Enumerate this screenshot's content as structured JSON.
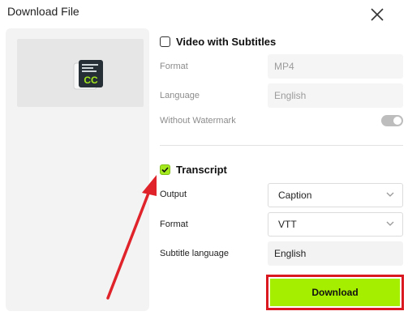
{
  "dialog": {
    "title": "Download File"
  },
  "video_section": {
    "title": "Video with Subtitles",
    "checked": false,
    "format_label": "Format",
    "format_value": "MP4",
    "language_label": "Language",
    "language_value": "English",
    "watermark_label": "Without Watermark",
    "watermark_enabled": true
  },
  "transcript_section": {
    "title": "Transcript",
    "checked": true,
    "output_label": "Output",
    "output_value": "Caption",
    "format_label": "Format",
    "format_value": "VTT",
    "subtitle_language_label": "Subtitle language",
    "subtitle_language_value": "English"
  },
  "download_button": {
    "label": "Download"
  },
  "icons": {
    "preview": "cc-subtitle-icon",
    "close": "close-icon",
    "chevron": "chevron-down-icon",
    "check": "check-icon"
  },
  "colors": {
    "accent": "#a6ee00",
    "highlight": "#d9191f"
  }
}
